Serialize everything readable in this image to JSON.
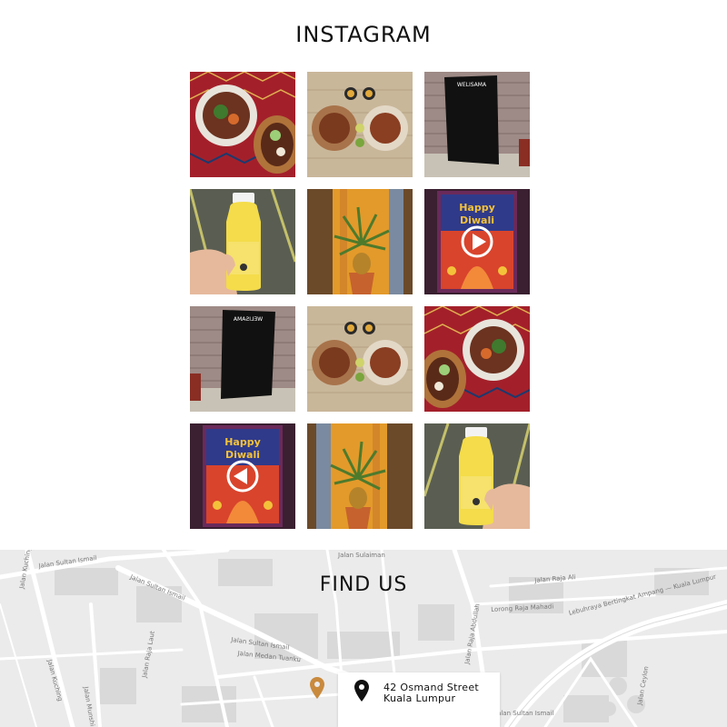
{
  "instagram": {
    "title": "INSTAGRAM",
    "photos": [
      {
        "alt": "food-platter-on-red-rug",
        "video": false
      },
      {
        "alt": "two-bowls-on-wood",
        "video": false
      },
      {
        "alt": "welisama-chalkboard-sign",
        "video": false
      },
      {
        "alt": "yellow-juice-bottle",
        "video": false
      },
      {
        "alt": "pineapple-plant",
        "video": false
      },
      {
        "alt": "happy-diwali-poster",
        "video": true
      },
      {
        "alt": "welisama-chalkboard-sign",
        "video": false
      },
      {
        "alt": "two-bowls-on-wood",
        "video": false
      },
      {
        "alt": "food-platter-on-red-rug",
        "video": false
      },
      {
        "alt": "happy-diwali-poster",
        "video": true
      },
      {
        "alt": "pineapple-plant",
        "video": false
      },
      {
        "alt": "yellow-juice-bottle",
        "video": false
      }
    ],
    "sign_text": "WELISAMA",
    "poster_text_1": "Happy",
    "poster_text_2": "Diwali"
  },
  "find_us": {
    "title": "FIND US",
    "address_line1": "42 Osmand Street",
    "address_line2": "Kuala Lumpur",
    "marker_color": "#c98a3d",
    "streets": [
      "Jalan Sultan Ismail",
      "Jalan Sultan Ismail",
      "Jalan Sulaiman",
      "Jalan Raja Ali",
      "Lorong Raja Mahadi",
      "Lebuhraya Bertingkat Ampang — Kuala Lumpur",
      "Jalan Raja Abdullah",
      "Jalan Sultan Ismail",
      "Jalan Medan Tuanku",
      "Jalan Raja Laut",
      "Jalan Kuching",
      "Jalan Kuching",
      "Jalan Munshi",
      "Jalan Ceylon",
      "Jalan Sultan Ismail"
    ]
  }
}
